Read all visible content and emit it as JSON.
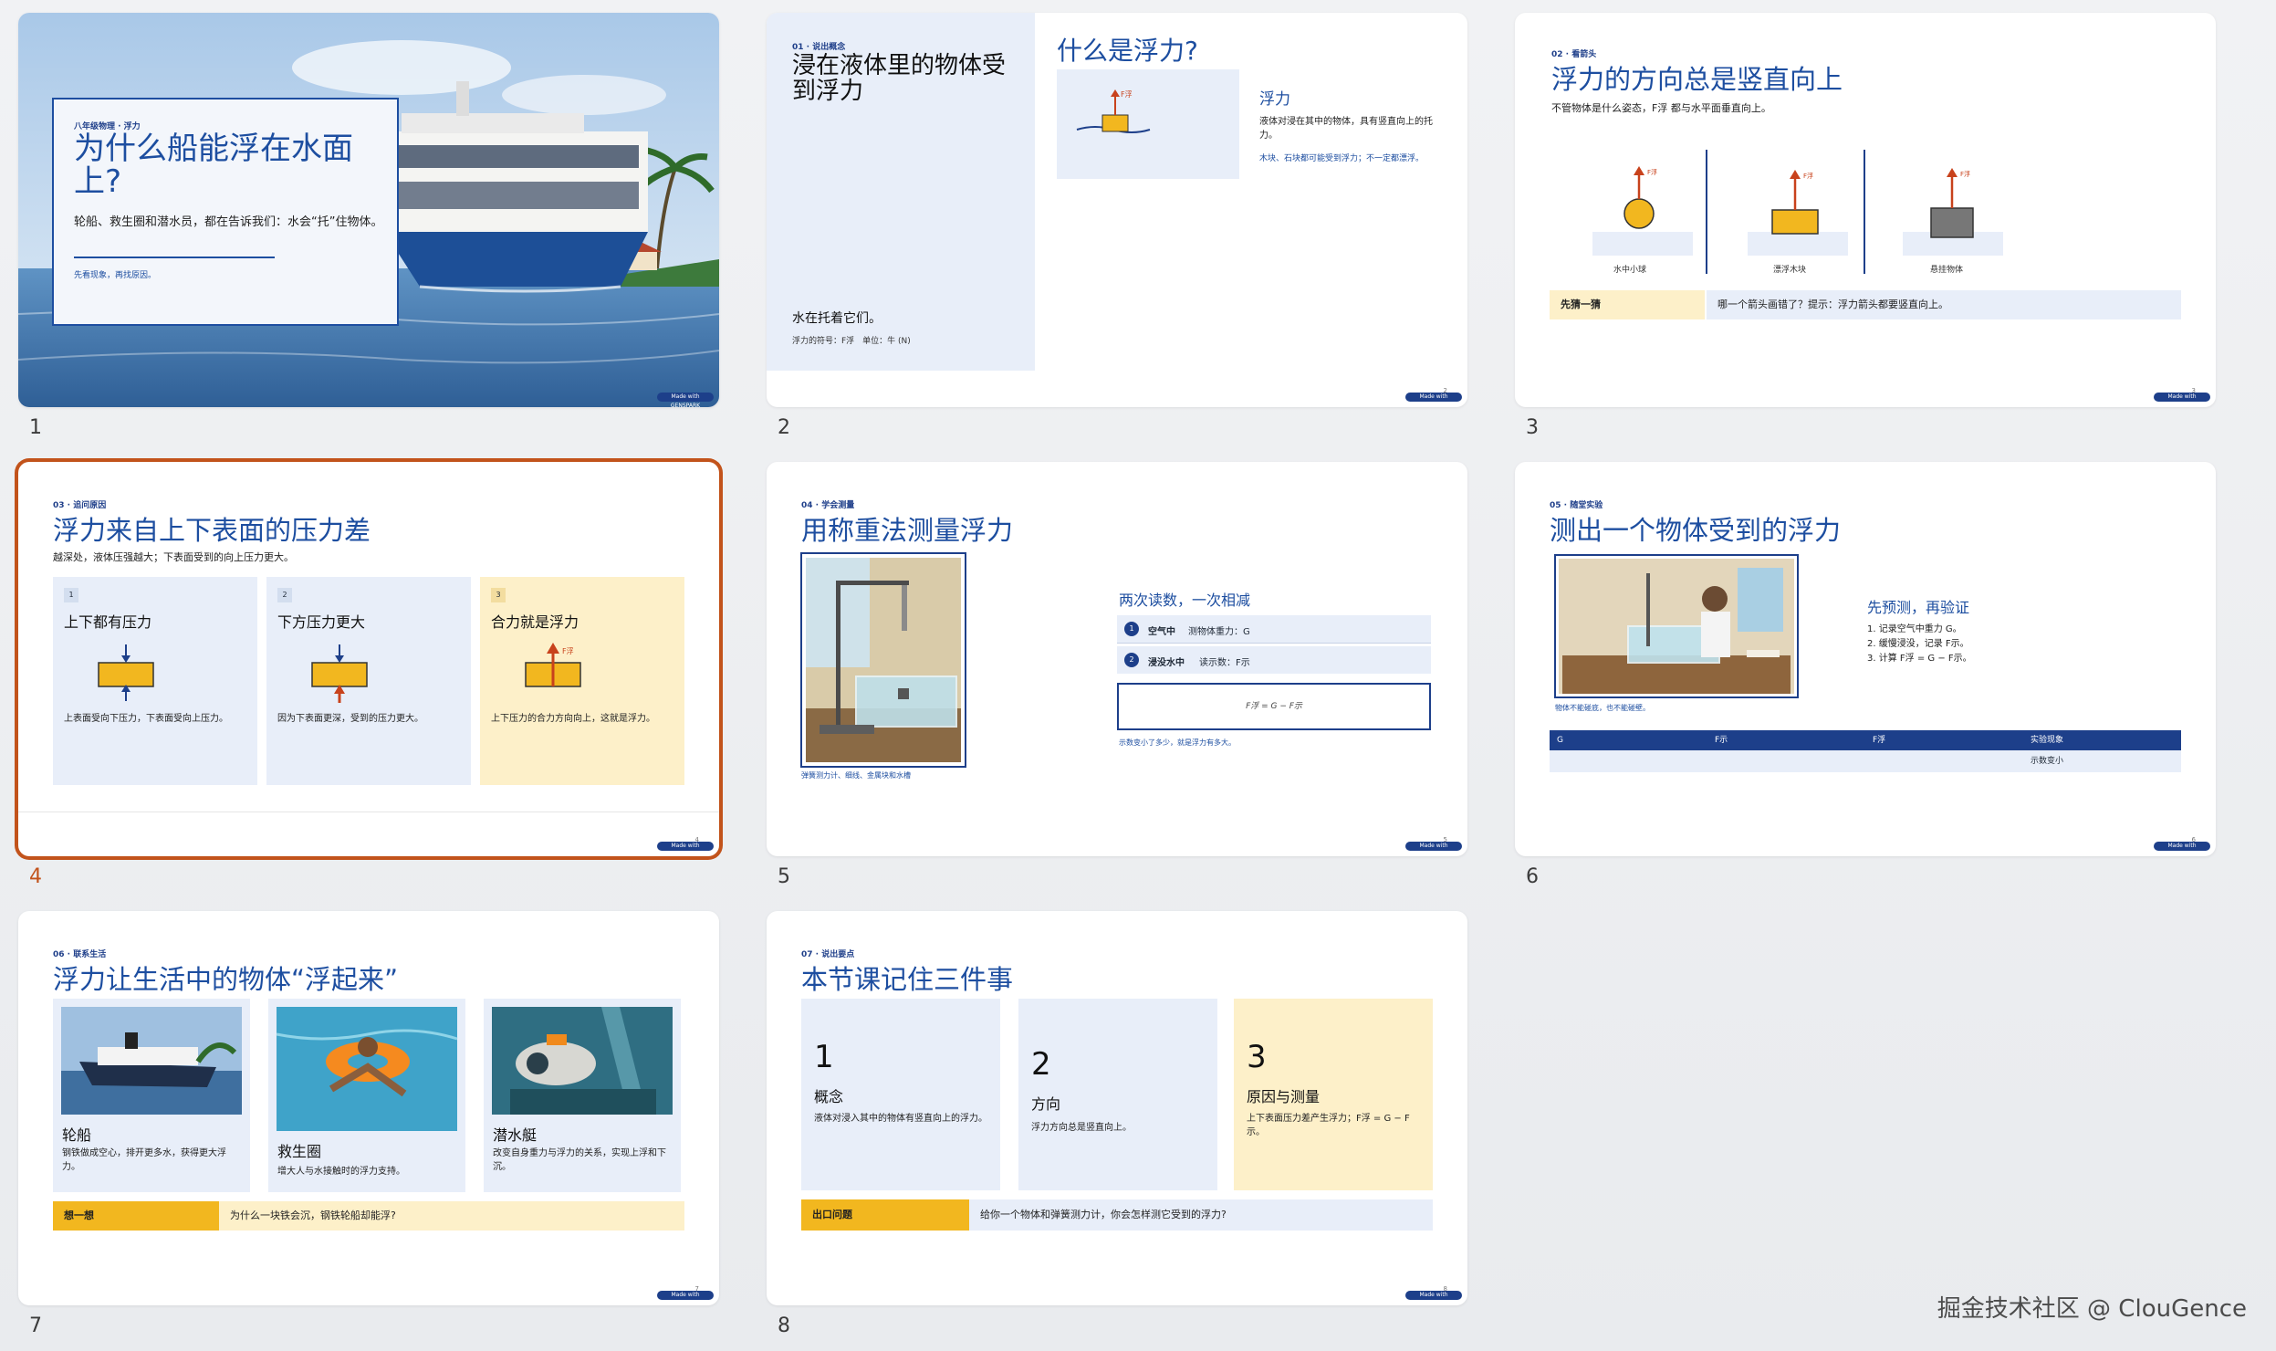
{
  "colors": {
    "accent": "#1d4ea0",
    "navy": "#1d3f8a",
    "card": "#e8eef9",
    "yellow": "#fdf0c9",
    "gold": "#f2b71f",
    "selected": "#c2531b",
    "arrow": "#c8421c"
  },
  "badge_label": "Made with GENSPARK",
  "slides": [
    {
      "num": "1",
      "section": "八年级物理 · 浮力",
      "title": "为什么船能浮在水面上?",
      "subtitle": "轮船、救生圈和潜水员，都在告诉我们：水会“托”住物体。",
      "note": "先看现象，再找原因。"
    },
    {
      "num": "2",
      "section": "01 · 说出概念",
      "title": "浸在液体里的物体受到浮力",
      "caption": "水在托着它们。",
      "footnote": "浮力的符号：F浮　单位：牛 (N)",
      "right_title": "什么是浮力?",
      "term": "浮力",
      "definition": "液体对浸在其中的物体，具有竖直向上的托力。",
      "example": "木块、石块都可能受到浮力；不一定都漂浮。",
      "arrow_label": "F浮",
      "page": "2"
    },
    {
      "num": "3",
      "section": "02 · 看箭头",
      "title": "浮力的方向总是竖直向上",
      "subtitle": "不管物体是什么姿态，F浮 都与水平面垂直向上。",
      "items": [
        {
          "label": "水中小球",
          "arrow": "F浮"
        },
        {
          "label": "漂浮木块",
          "arrow": "F浮"
        },
        {
          "label": "悬挂物体",
          "arrow": "F浮"
        }
      ],
      "guess_label": "先猜一猜",
      "guess_text": "哪一个箭头画错了？提示：浮力箭头都要竖直向上。",
      "page": "3"
    },
    {
      "num": "4",
      "section": "03 · 追问原因",
      "title": "浮力来自上下表面的压力差",
      "subtitle": "越深处，液体压强越大；下表面受到的向上压力更大。",
      "cards": [
        {
          "n": "1",
          "title": "上下都有压力",
          "text": "上表面受向下压力，下表面受向上压力。"
        },
        {
          "n": "2",
          "title": "下方压力更大",
          "text": "因为下表面更深，受到的压力更大。"
        },
        {
          "n": "3",
          "title": "合力就是浮力",
          "text": "上下压力的合力方向向上，这就是浮力。",
          "arrow": "F浮"
        }
      ],
      "page": "4"
    },
    {
      "num": "5",
      "section": "04 · 学会测量",
      "title": "用称重法测量浮力",
      "image_caption": "弹簧测力计、细线、金属块和水槽",
      "subtitle": "两次读数，一次相减",
      "steps": [
        {
          "n": "1",
          "bold": "空气中",
          "text": "测物体重力：G"
        },
        {
          "n": "2",
          "bold": "浸没水中",
          "text": "读示数：F示"
        }
      ],
      "formula": "F浮 = G − F示",
      "note": "示数变小了多少，就是浮力有多大。",
      "page": "5"
    },
    {
      "num": "6",
      "section": "05 · 随堂实验",
      "title": "测出一个物体受到的浮力",
      "image_caption": "物体不能碰底，也不能碰壁。",
      "subtitle": "先预测，再验证",
      "steps": [
        "1.  记录空气中重力 G。",
        "2.  缓慢浸没，记录 F示。",
        "3.  计算 F浮 = G − F示。"
      ],
      "table_headers": [
        "G",
        "F示",
        "F浮",
        "实验现象"
      ],
      "table_row": [
        "",
        "",
        "",
        "示数变小"
      ],
      "page": "6"
    },
    {
      "num": "7",
      "section": "06 · 联系生活",
      "title": "浮力让生活中的物体“浮起来”",
      "cards": [
        {
          "title": "轮船",
          "text": "钢铁做成空心，排开更多水，获得更大浮力。",
          "icon": "ship-image"
        },
        {
          "title": "救生圈",
          "text": "增大人与水接触时的浮力支持。",
          "icon": "swim-ring-image"
        },
        {
          "title": "潜水艇",
          "text": "改变自身重力与浮力的关系，实现上浮和下沉。",
          "icon": "submarine-image"
        }
      ],
      "think_label": "想一想",
      "think_text": "为什么一块铁会沉，钢铁轮船却能浮?",
      "page": "7"
    },
    {
      "num": "8",
      "section": "07 · 说出要点",
      "title": "本节课记住三件事",
      "cards": [
        {
          "n": "1",
          "title": "概念",
          "text": "液体对浸入其中的物体有竖直向上的浮力。"
        },
        {
          "n": "2",
          "title": "方向",
          "text": "浮力方向总是竖直向上。"
        },
        {
          "n": "3",
          "title": "原因与测量",
          "text": "上下表面压力差产生浮力；F浮 = G − F示。"
        }
      ],
      "exit_label": "出口问题",
      "exit_text": "给你一个物体和弹簧测力计，你会怎样测它受到的浮力?",
      "page": "8"
    }
  ],
  "watermark": "掘金技术社区 @ ClouGence"
}
